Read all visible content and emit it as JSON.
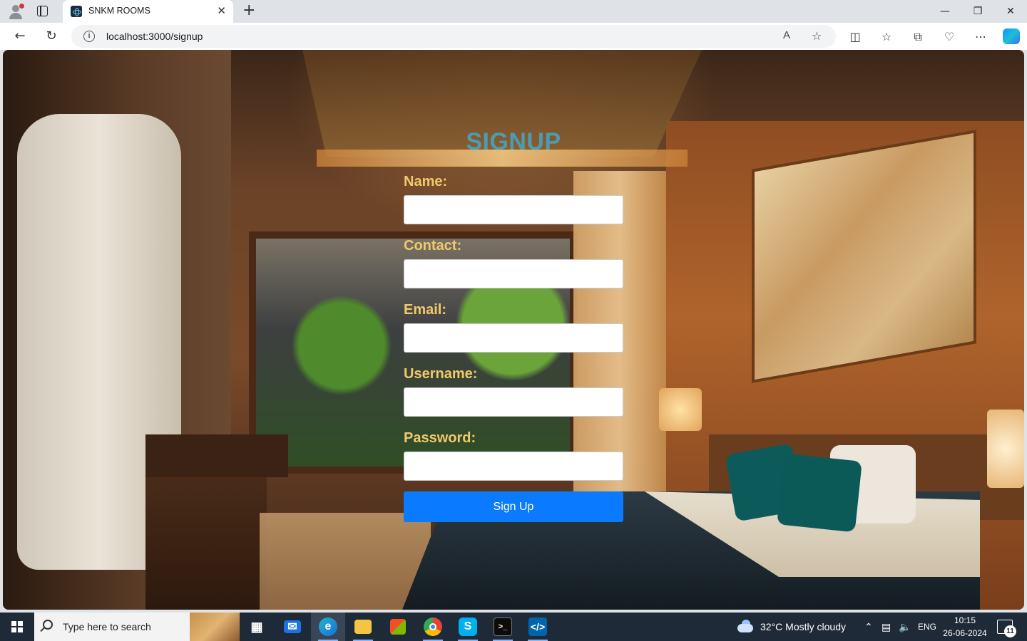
{
  "browser": {
    "tab_title": "SNKM ROOMS",
    "url": "localhost:3000/signup",
    "close_tab_glyph": "✕",
    "new_tab_glyph": "+",
    "window_controls": {
      "minimize": "—",
      "maximize": "❐",
      "close": "✕"
    },
    "read_aloud_glyph": "A",
    "favorite_glyph": "☆"
  },
  "page": {
    "title": "SIGNUP",
    "fields": [
      {
        "label": "Name:",
        "value": ""
      },
      {
        "label": "Contact:",
        "value": ""
      },
      {
        "label": "Email:",
        "value": ""
      },
      {
        "label": "Username:",
        "value": ""
      },
      {
        "label": "Password:",
        "value": ""
      }
    ],
    "submit_label": "Sign Up",
    "colors": {
      "title": "#4e9bb0",
      "label": "#f2c96a",
      "button": "#0a7bff"
    }
  },
  "taskbar": {
    "search_placeholder": "Type here to search",
    "weather": "32°C  Mostly cloudy",
    "language": "ENG",
    "time": "10:15",
    "date": "26-06-2024",
    "notification_count": "11",
    "apps": [
      "task-view",
      "mail",
      "edge",
      "file-explorer",
      "store",
      "chrome",
      "skype",
      "terminal",
      "vscode"
    ]
  }
}
